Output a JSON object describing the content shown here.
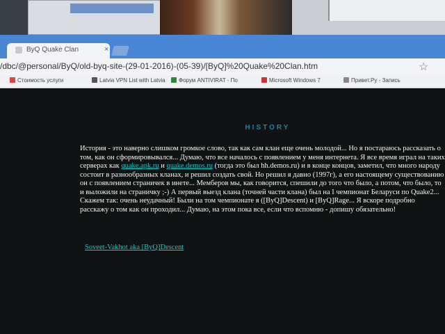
{
  "browser": {
    "tab_title": "ByQ Quake Clan",
    "tab_close": "×",
    "url": "/dbc/@personal/ByQ/old-byq-site-(29-01-2016)-(05-39)/[ByQ]%20Quake%20Clan.htm",
    "bookmarks": [
      {
        "label": "Стоимость услуги",
        "icon_color": "#d44"
      },
      {
        "label": "Latvia VPN List with Latvia",
        "icon_color": "#555"
      },
      {
        "label": "Форум ANTIVIRAT - По",
        "icon_color": "#2a8a3a"
      },
      {
        "label": "Microsoft Windows 7",
        "icon_color": "#c33"
      },
      {
        "label": "Привет.Ру - Запись",
        "icon_color": "#888"
      }
    ]
  },
  "page": {
    "heading": "HISTORY",
    "paragraph": {
      "text1": "История - это наверно слишком громкое слово, так как сам клан еще очень молодой... Но я постараюсь рассказать о том, как он сформировывался... Думаю, что все началось с появлением у меня интернета. Я все время играл на таких серверах как ",
      "link1": "quake.apk.ru",
      "text2": " и ",
      "link2": "quake.demos.ru",
      "text3": " (тогда это был hh.demos.ru) и в конце концов, заметил, что много народу состоит в разнообразных кланах, и решил создать свой. Но решил я давно (1997г), а его настоящему существованию он с появлением страничек в инете... Мемберов мы, как говорится, спешили до того что было, а потом, что было, то и выложили на страничку ;-) А первый выезд клана (точней части клана) был на I чемпионат Беларуси по Quake2... Скажем так: очень неудачный! Были на том чемпионате я ([ByQ]Descent) и [ByQ]Rage... Я вскоре подробно расскажу о том как он проходил... Думаю, на этом пока все, если что вспомню - допишу обязательно!"
    },
    "signature": "Soveet-Vakhot aka [ByQ]Descent"
  },
  "colors": {
    "page_bg": "#101314",
    "heading": "#1f7fae",
    "text": "#f4f4f4",
    "link": "#17c9cf",
    "tabbar": "#4a86d6"
  }
}
